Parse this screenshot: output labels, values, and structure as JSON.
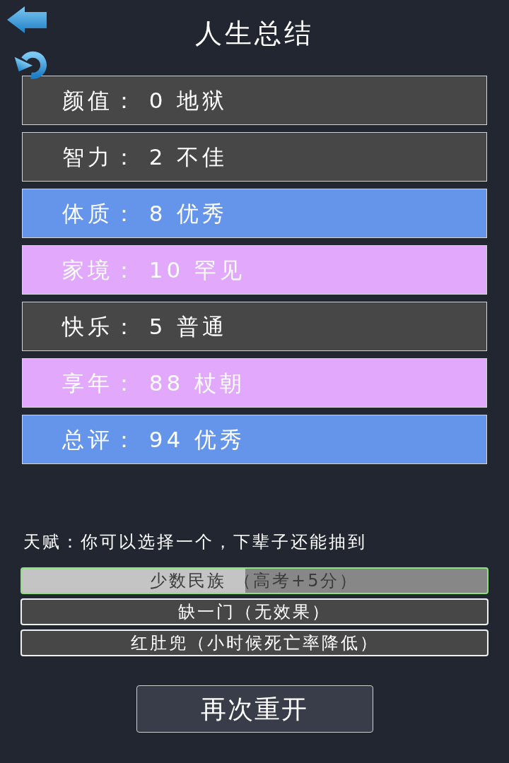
{
  "header": {
    "title": "人生总结"
  },
  "stats": [
    {
      "text": "颜值： 0 地狱",
      "color": "#474747"
    },
    {
      "text": "智力： 2 不佳",
      "color": "#474747"
    },
    {
      "text": "体质： 8 优秀",
      "color": "#6495ea"
    },
    {
      "text": "家境： 10 罕见",
      "color": "#e1a8fc"
    },
    {
      "text": "快乐： 5 普通",
      "color": "#474747"
    },
    {
      "text": "享年： 88 杖朝",
      "color": "#e1a8fc"
    },
    {
      "text": "总评： 94 优秀",
      "color": "#6495ea"
    }
  ],
  "talents": {
    "prompt": "天赋：你可以选择一个，下辈子还能抽到",
    "options": [
      {
        "text": "少数民族 （高考+5分）",
        "selected": true,
        "level": 0.48
      },
      {
        "text": "缺一门（无效果）",
        "selected": false
      },
      {
        "text": "红肚兜（小时候死亡率降低）",
        "selected": false
      }
    ]
  },
  "restart_button": {
    "label": "再次重开"
  }
}
